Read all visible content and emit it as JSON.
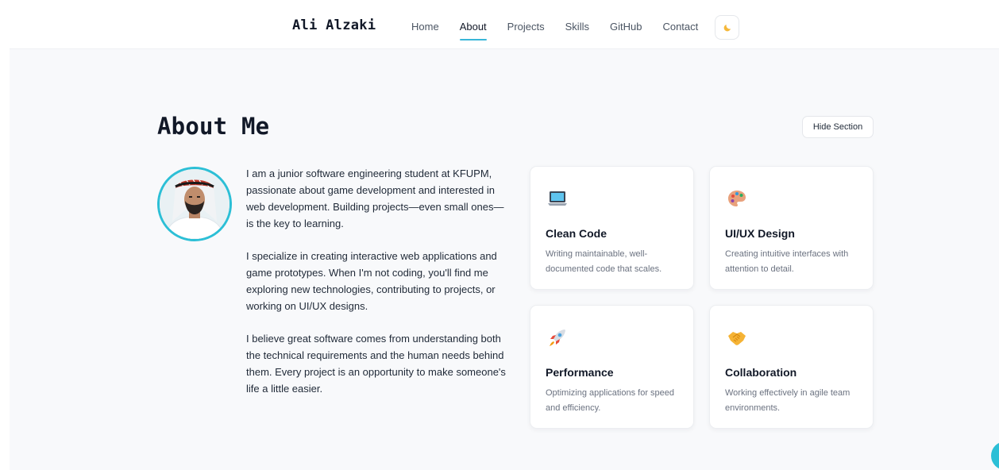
{
  "nav": {
    "brand": "Ali Alzaki",
    "links": [
      {
        "label": "Home"
      },
      {
        "label": "About"
      },
      {
        "label": "Projects"
      },
      {
        "label": "Skills"
      },
      {
        "label": "GitHub"
      },
      {
        "label": "Contact"
      }
    ],
    "active": "About",
    "theme_icon": "moon-icon"
  },
  "about": {
    "title": "About Me",
    "hide_button": "Hide Section",
    "paragraphs": [
      "I am a junior software engineering student at KFUPM, passionate about game development and interested in web development. Building projects—even small ones—is the key to learning.",
      "I specialize in creating interactive web applications and game prototypes. When I'm not coding, you'll find me exploring new technologies, contributing to projects, or working on UI/UX designs.",
      "I believe great software comes from understanding both the technical requirements and the human needs behind them. Every project is an opportunity to make someone's life a little easier."
    ],
    "cards": [
      {
        "icon": "laptop-icon",
        "title": "Clean Code",
        "desc": "Writing maintainable, well-documented code that scales."
      },
      {
        "icon": "palette-icon",
        "title": "UI/UX Design",
        "desc": "Creating intuitive interfaces with attention to detail."
      },
      {
        "icon": "rocket-icon",
        "title": "Performance",
        "desc": "Optimizing applications for speed and efficiency."
      },
      {
        "icon": "handshake-icon",
        "title": "Collaboration",
        "desc": "Working effectively in agile team environments."
      }
    ]
  },
  "colors": {
    "accent": "#2cbfd6",
    "background": "#f8f9fb",
    "text": "#1f2937",
    "muted": "#6b7280"
  }
}
